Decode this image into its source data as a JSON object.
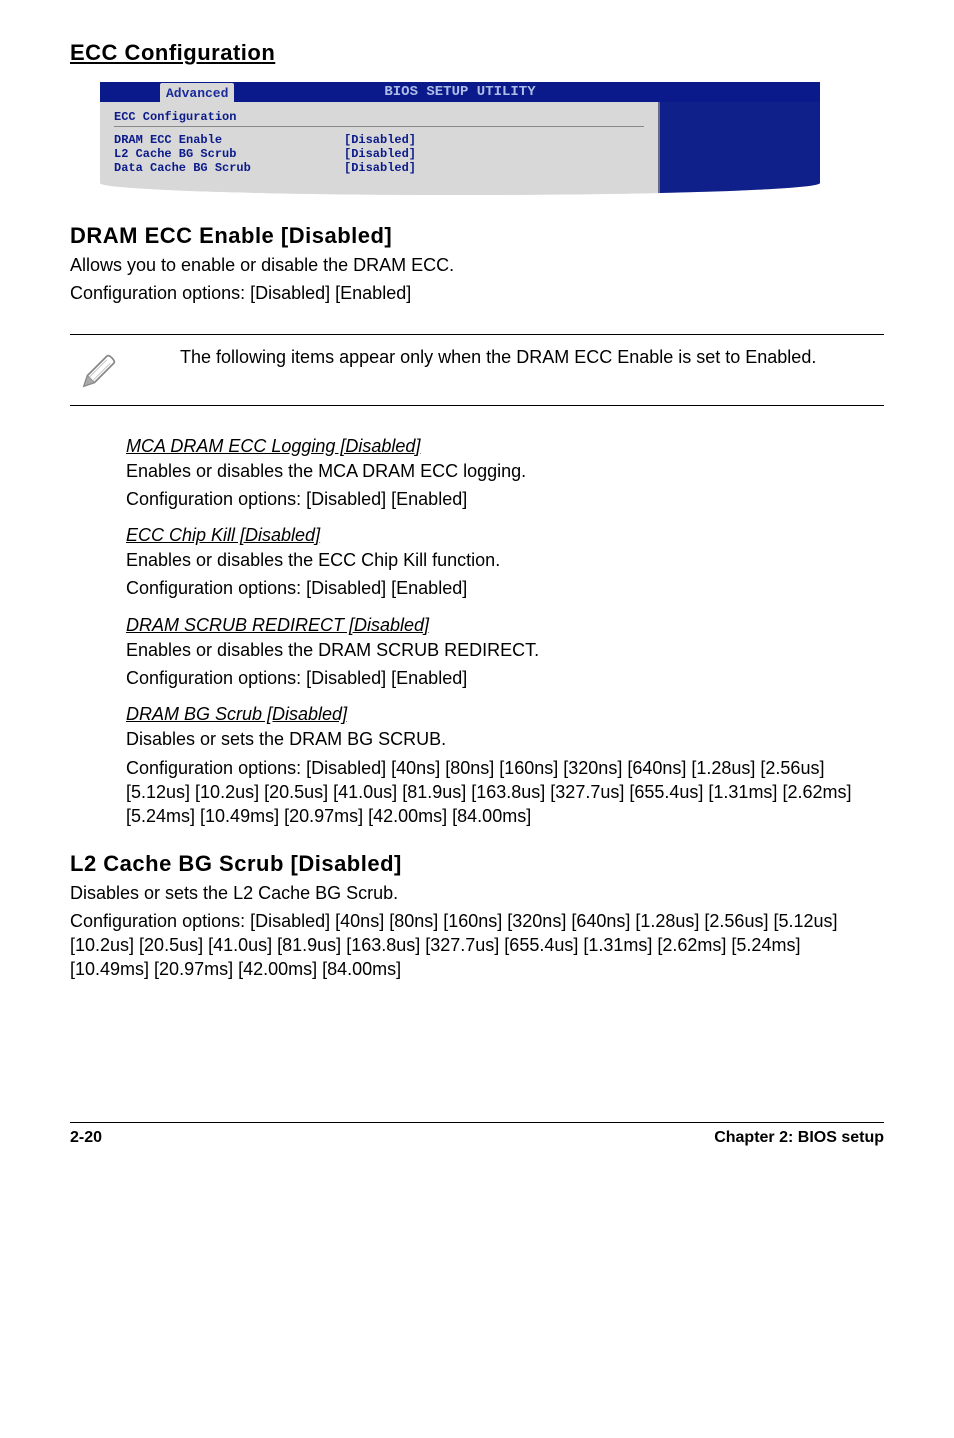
{
  "headings": {
    "ecc_config": "ECC Configuration",
    "dram_ecc_enable": "DRAM ECC Enable [Disabled]",
    "l2_cache_scrub": "L2 Cache BG Scrub [Disabled]"
  },
  "bios": {
    "title": "BIOS SETUP UTILITY",
    "tab": "Advanced",
    "section": "ECC Configuration",
    "rows": [
      {
        "label": "DRAM ECC Enable",
        "value": "[Disabled]"
      },
      {
        "label": "L2 Cache BG Scrub",
        "value": "[Disabled]"
      },
      {
        "label": "Data Cache BG Scrub",
        "value": "[Disabled]"
      }
    ]
  },
  "dram_ecc_desc1": "Allows you to enable or disable the DRAM ECC.",
  "dram_ecc_desc2": "Configuration options: [Disabled] [Enabled]",
  "note": "The following items appear only when the DRAM ECC Enable is set to Enabled.",
  "sub_items": {
    "mca": {
      "title": "MCA DRAM ECC Logging [Disabled]",
      "line1": "Enables or disables the MCA DRAM ECC logging.",
      "line2": "Configuration options: [Disabled] [Enabled]"
    },
    "chipkill": {
      "title": "ECC Chip Kill [Disabled]",
      "line1": "Enables or disables the ECC Chip Kill function.",
      "line2": "Configuration options: [Disabled] [Enabled]"
    },
    "redirect": {
      "title": "DRAM SCRUB REDIRECT [Disabled]",
      "line1": "Enables or disables the DRAM SCRUB REDIRECT.",
      "line2": "Configuration options: [Disabled] [Enabled]"
    },
    "bgscrub": {
      "title": "DRAM BG Scrub [Disabled]",
      "line1": "Disables or sets the DRAM BG SCRUB.",
      "line2": "Configuration options: [Disabled] [40ns] [80ns] [160ns] [320ns] [640ns] [1.28us] [2.56us] [5.12us] [10.2us] [20.5us] [41.0us] [81.9us] [163.8us] [327.7us] [655.4us] [1.31ms] [2.62ms] [5.24ms] [10.49ms] [20.97ms] [42.00ms] [84.00ms]"
    }
  },
  "l2_desc1": "Disables or sets the L2 Cache BG Scrub.",
  "l2_desc2": "Configuration options: [Disabled] [40ns] [80ns] [160ns] [320ns] [640ns] [1.28us] [2.56us] [5.12us] [10.2us] [20.5us] [41.0us] [81.9us] [163.8us] [327.7us] [655.4us] [1.31ms] [2.62ms] [5.24ms] [10.49ms] [20.97ms] [42.00ms] [84.00ms]",
  "footer": {
    "page": "2-20",
    "chapter": "Chapter 2: BIOS setup"
  }
}
